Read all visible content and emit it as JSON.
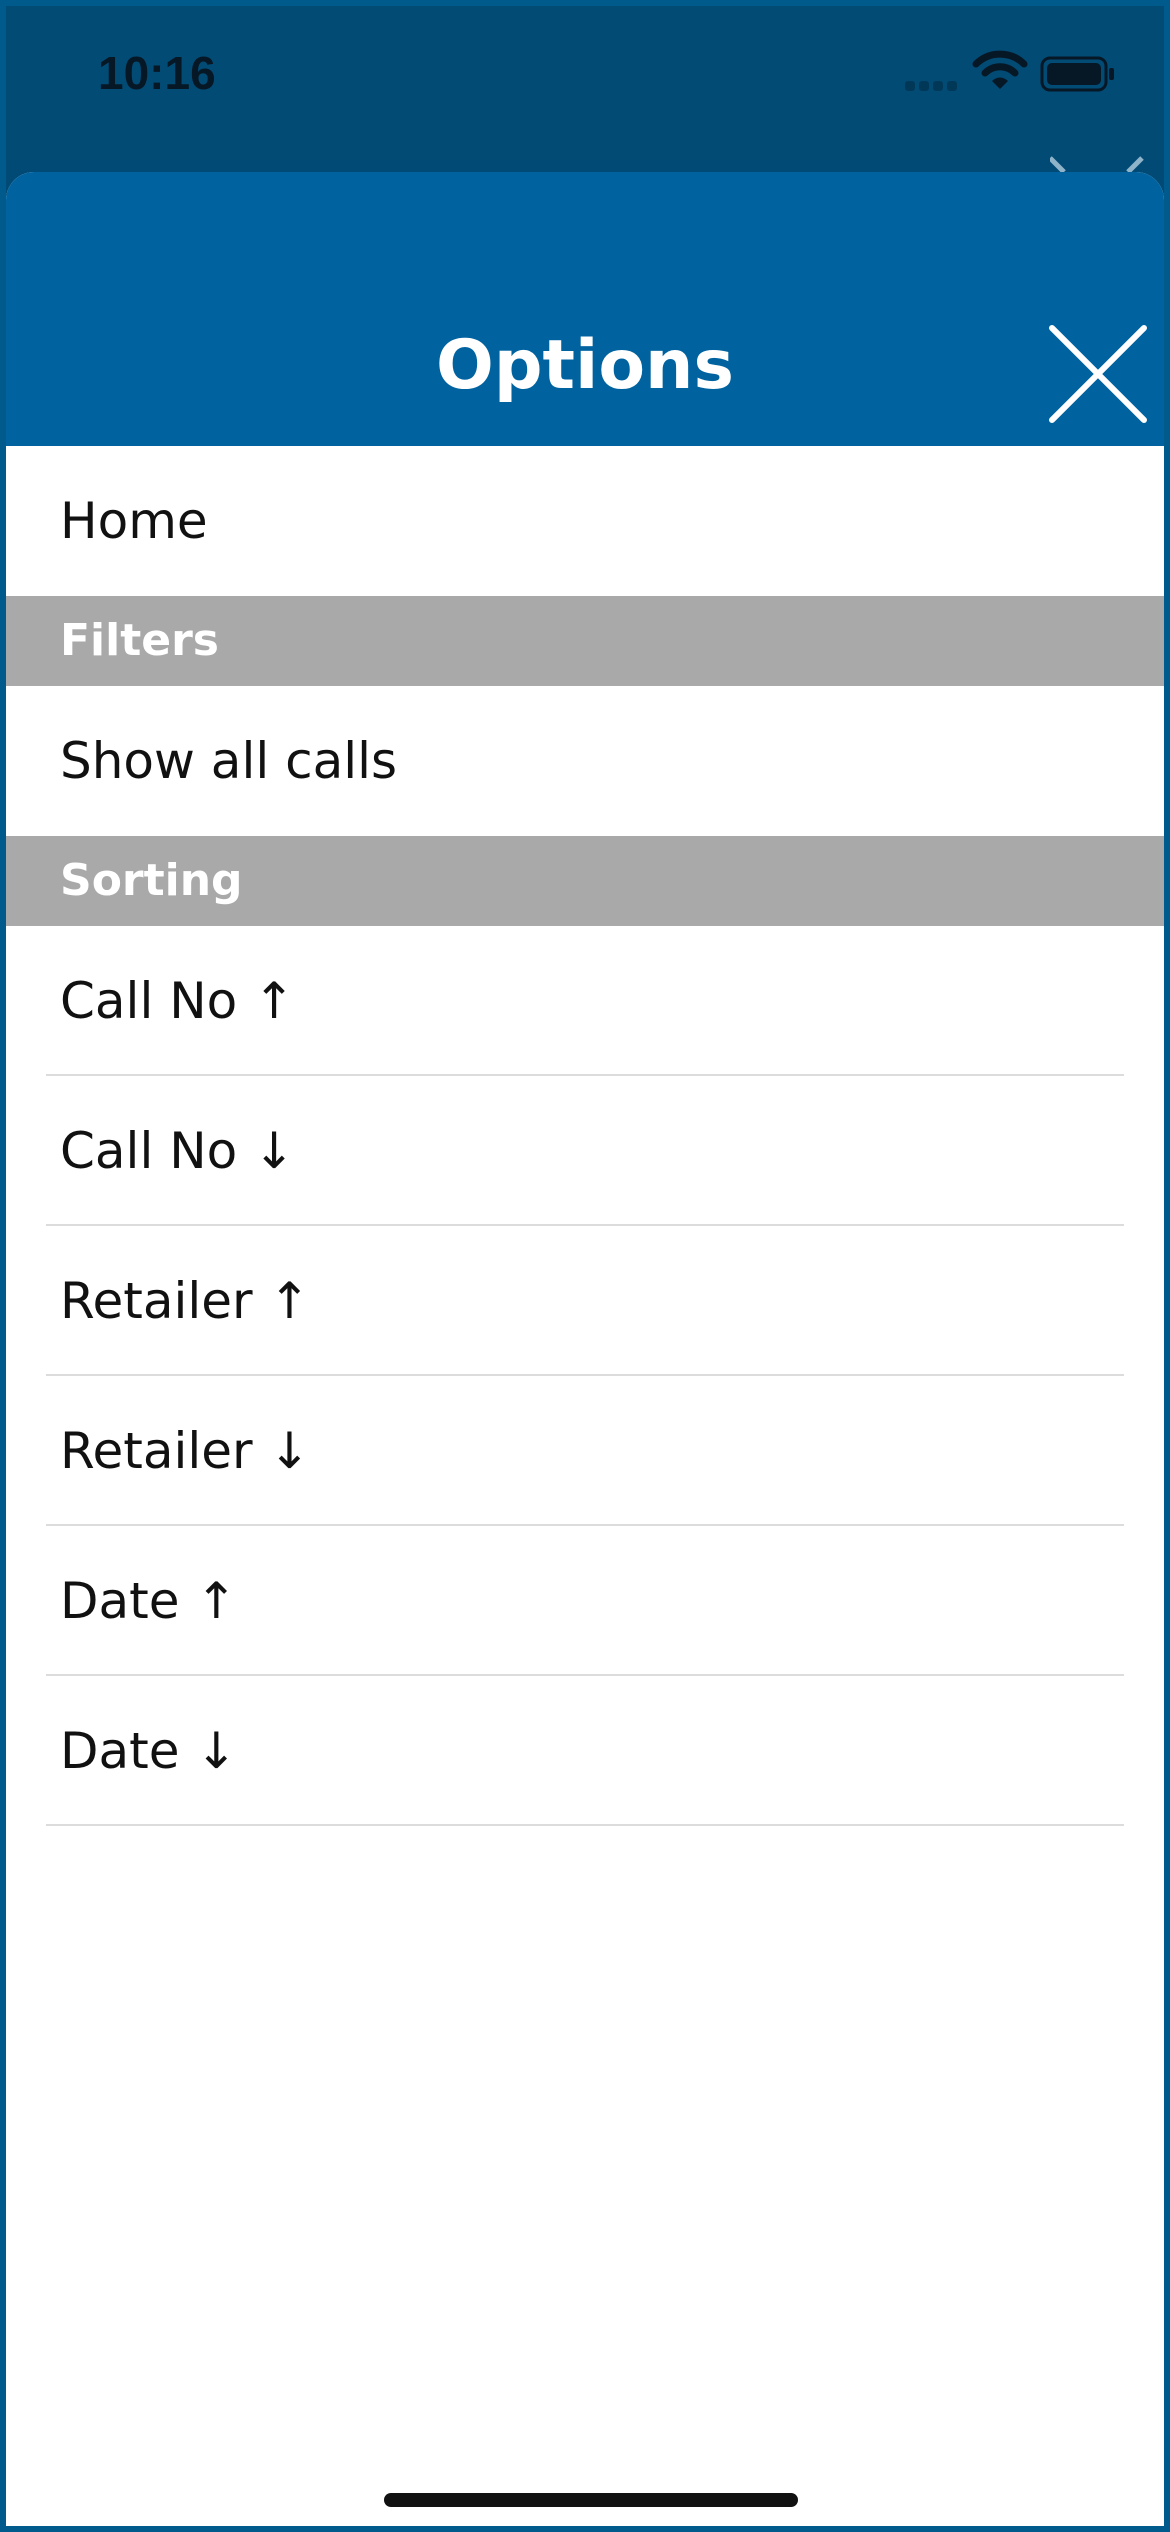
{
  "status_bar": {
    "time": "10:16",
    "icons": [
      "cellular-signal-icon",
      "wifi-icon",
      "battery-icon"
    ]
  },
  "sheet": {
    "title": "Options",
    "close_icon": "close-icon",
    "header_color": "#0063a0",
    "section_color": "#a9a9a9",
    "home_label": "Home",
    "filters": {
      "header": "Filters",
      "items": [
        "Show all calls"
      ]
    },
    "sorting": {
      "header": "Sorting",
      "items": [
        "Call No ↑",
        "Call No ↓",
        "Retailer ↑",
        "Retailer ↓",
        "Date ↑",
        "Date ↓"
      ]
    }
  }
}
